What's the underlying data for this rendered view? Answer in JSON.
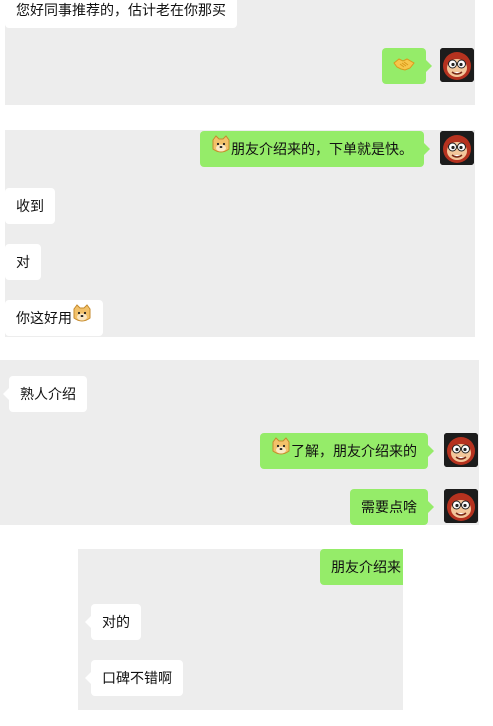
{
  "messages": {
    "m1": "您好同事推荐的，估计老在你那买",
    "m3_text": "朋友介绍来的，下单就是快。",
    "m4": "收到",
    "m5": "对",
    "m6_text": "你这好用",
    "m7": "熟人介绍",
    "m8_text": "了解，朋友介绍来的",
    "m9": "需要点啥",
    "m10": "朋友介绍来",
    "m11": "对的",
    "m12": "口碑不错啊"
  },
  "icons": {
    "avatar": "monkey-avatar-icon",
    "handshake": "handshake-emoji-icon",
    "doge": "doge-emoji-icon"
  },
  "colors": {
    "chat_bg": "#ededed",
    "incoming_bubble": "#ffffff",
    "outgoing_bubble": "#95ec69"
  }
}
